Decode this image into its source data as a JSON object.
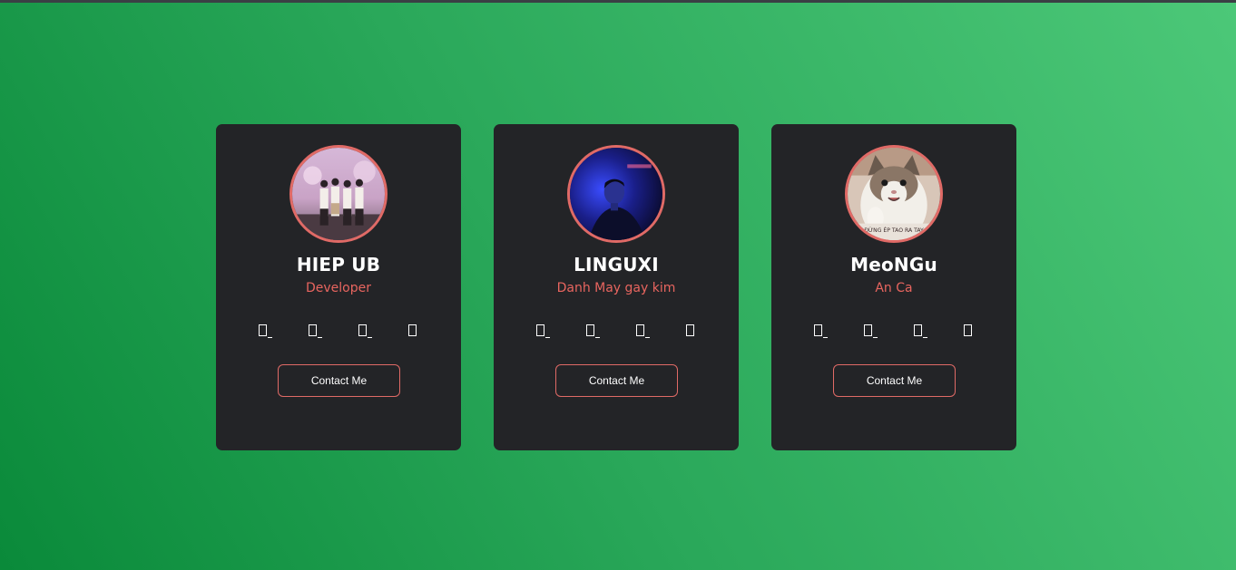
{
  "cards": [
    {
      "name": "HIEP UB",
      "role": "Developer",
      "button_label": "Contact Me",
      "avatar": "group-photo",
      "social_icons": [
        "missing-glyph-icon",
        "missing-glyph-icon",
        "missing-glyph-icon",
        "missing-glyph-icon"
      ]
    },
    {
      "name": "LINGUXI",
      "role": "Danh May gay kim",
      "button_label": "Contact Me",
      "avatar": "portrait-blue-light",
      "social_icons": [
        "missing-glyph-icon",
        "missing-glyph-icon",
        "missing-glyph-icon",
        "missing-glyph-icon"
      ]
    },
    {
      "name": "MeoNGu",
      "role": "An Ca",
      "button_label": "Contact Me",
      "avatar": "cat-meme",
      "avatar_caption": "ĐỪNG ÉP TAO RA TAY",
      "social_icons": [
        "missing-glyph-icon",
        "missing-glyph-icon",
        "missing-glyph-icon",
        "missing-glyph-icon"
      ]
    }
  ],
  "colors": {
    "background_start": "#0a8a3a",
    "background_end": "#4cc878",
    "card_bg": "#232427",
    "accent": "#e06a66",
    "role_text": "#e8655f",
    "name_text": "#ffffff"
  }
}
